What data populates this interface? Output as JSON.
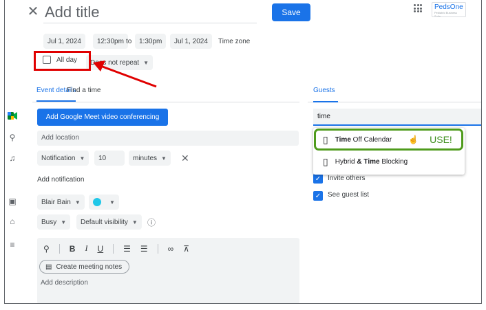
{
  "header": {
    "title_placeholder": "Add title",
    "save_label": "Save",
    "brand_name": "PedsOne",
    "brand_tagline": "Pediatric Business Suite"
  },
  "datetime": {
    "start_date": "Jul 1, 2024",
    "start_time": "12:30pm",
    "to_label": "to",
    "end_time": "1:30pm",
    "end_date": "Jul 1, 2024",
    "timezone_label": "Time zone",
    "all_day_label": "All day",
    "repeat_label": "Does not repeat"
  },
  "tabs": {
    "event_details": "Event details",
    "find_time": "Find a time",
    "guests": "Guests"
  },
  "details": {
    "meet_button": "Add Google Meet video conferencing",
    "location_placeholder": "Add location",
    "notification_type": "Notification",
    "notification_value": "10",
    "notification_unit": "minutes",
    "add_notification": "Add notification",
    "calendar_owner": "Blair Bain",
    "calendar_color": "#20c7e8",
    "busy_status": "Busy",
    "visibility": "Default visibility",
    "create_notes": "Create meeting notes",
    "description_placeholder": "Add description"
  },
  "guests": {
    "search_value": "time",
    "suggestions": [
      {
        "bold": "Time",
        "rest": " Off Calendar"
      },
      {
        "pre": "Hybrid ",
        "bold": "& Time",
        "rest": " Blocking"
      }
    ],
    "use_annotation": "USE!",
    "permissions": [
      "Invite others",
      "See guest list"
    ]
  },
  "annotations": {
    "red_color": "#e00000",
    "green_color": "#4f9b1c"
  }
}
